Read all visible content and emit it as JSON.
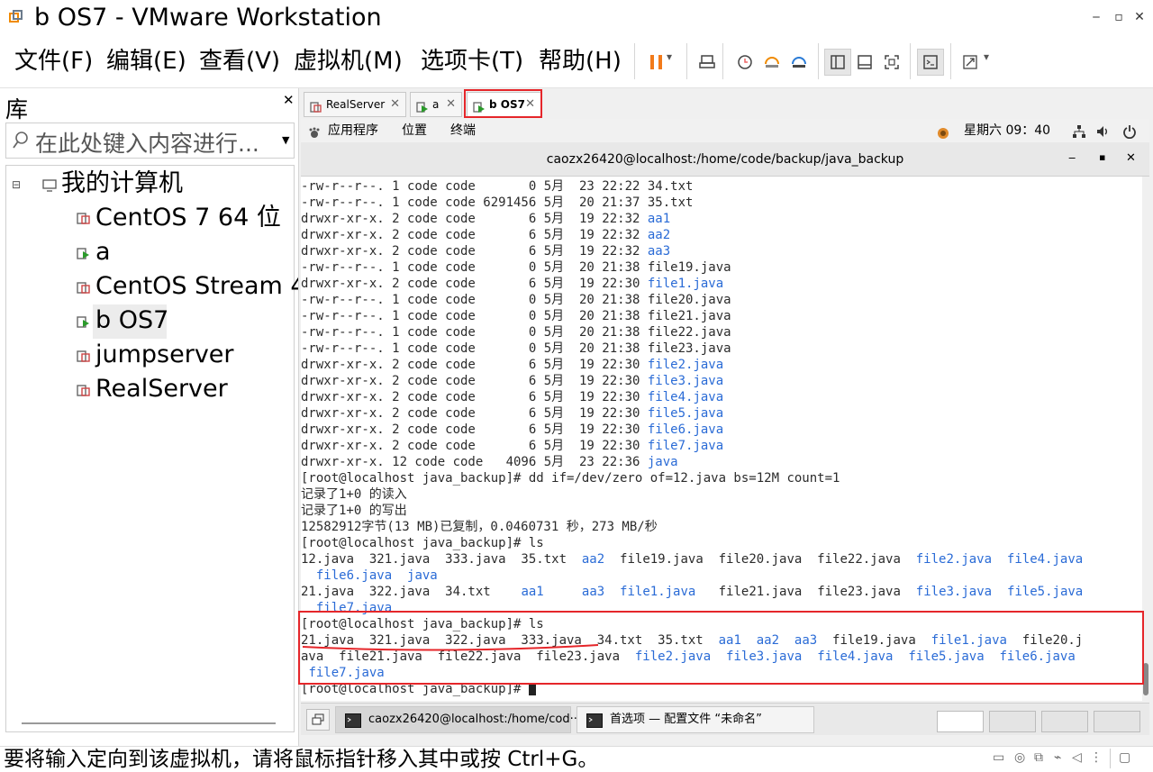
{
  "window": {
    "title": "b OS7 - VMware Workstation",
    "minimize": "‒",
    "restore": "▫",
    "close": "✕"
  },
  "menu": [
    "文件(F)",
    "编辑(E)",
    "查看(V)",
    "虚拟机(M)",
    "选项卡(T)",
    "帮助(H)"
  ],
  "toolbar": {
    "pause_icon": "pause-icon",
    "dropdown": "▾"
  },
  "library": {
    "title": "库",
    "close": "✕",
    "search_placeholder": "在此处键入内容进行...",
    "root": "我的计算机",
    "vms": [
      "CentOS 7 64 位",
      "a",
      "CentOS Stream 4",
      "b OS7",
      "jumpserver",
      "RealServer"
    ],
    "selected": "b OS7"
  },
  "tabs": [
    {
      "label": "RealServer"
    },
    {
      "label": "a"
    },
    {
      "label": "b OS7",
      "active": true
    }
  ],
  "gnome": {
    "apps": "应用程序",
    "places": "位置",
    "terminal": "终端",
    "clock": "星期六 09：40"
  },
  "terminal": {
    "title": "caozx26420@localhost:/home/code/backup/java_backup",
    "lines": [
      [
        {
          "t": "-rw-r--r--. 1 code code       0 5月  23 22:22 34.txt"
        }
      ],
      [
        {
          "t": "-rw-r--r--. 1 code code 6291456 5月  20 21:37 35.txt"
        }
      ],
      [
        {
          "t": "drwxr-xr-x. 2 code code       6 5月  19 22:32 "
        },
        {
          "t": "aa1",
          "c": "blue"
        }
      ],
      [
        {
          "t": "drwxr-xr-x. 2 code code       6 5月  19 22:32 "
        },
        {
          "t": "aa2",
          "c": "blue"
        }
      ],
      [
        {
          "t": "drwxr-xr-x. 2 code code       6 5月  19 22:32 "
        },
        {
          "t": "aa3",
          "c": "blue"
        }
      ],
      [
        {
          "t": "-rw-r--r--. 1 code code       0 5月  20 21:38 file19.java"
        }
      ],
      [
        {
          "t": "drwxr-xr-x. 2 code code       6 5月  19 22:30 "
        },
        {
          "t": "file1.java",
          "c": "blue"
        }
      ],
      [
        {
          "t": "-rw-r--r--. 1 code code       0 5月  20 21:38 file20.java"
        }
      ],
      [
        {
          "t": "-rw-r--r--. 1 code code       0 5月  20 21:38 file21.java"
        }
      ],
      [
        {
          "t": "-rw-r--r--. 1 code code       0 5月  20 21:38 file22.java"
        }
      ],
      [
        {
          "t": "-rw-r--r--. 1 code code       0 5月  20 21:38 file23.java"
        }
      ],
      [
        {
          "t": "drwxr-xr-x. 2 code code       6 5月  19 22:30 "
        },
        {
          "t": "file2.java",
          "c": "blue"
        }
      ],
      [
        {
          "t": "drwxr-xr-x. 2 code code       6 5月  19 22:30 "
        },
        {
          "t": "file3.java",
          "c": "blue"
        }
      ],
      [
        {
          "t": "drwxr-xr-x. 2 code code       6 5月  19 22:30 "
        },
        {
          "t": "file4.java",
          "c": "blue"
        }
      ],
      [
        {
          "t": "drwxr-xr-x. 2 code code       6 5月  19 22:30 "
        },
        {
          "t": "file5.java",
          "c": "blue"
        }
      ],
      [
        {
          "t": "drwxr-xr-x. 2 code code       6 5月  19 22:30 "
        },
        {
          "t": "file6.java",
          "c": "blue"
        }
      ],
      [
        {
          "t": "drwxr-xr-x. 2 code code       6 5月  19 22:30 "
        },
        {
          "t": "file7.java",
          "c": "blue"
        }
      ],
      [
        {
          "t": "drwxr-xr-x. 12 code code   4096 5月  23 22:36 "
        },
        {
          "t": "java",
          "c": "blue"
        }
      ],
      [
        {
          "t": "[root@localhost java_backup]# dd if=/dev/zero of=12.java bs=12M count=1"
        }
      ],
      [
        {
          "t": "记录了1+0 的读入"
        }
      ],
      [
        {
          "t": "记录了1+0 的写出"
        }
      ],
      [
        {
          "t": "12582912字节(13 MB)已复制，0.0460731 秒，273 MB/秒"
        }
      ],
      [
        {
          "t": "[root@localhost java_backup]# ls"
        }
      ],
      [
        {
          "t": "12.java  321.java  333.java  35.txt  "
        },
        {
          "t": "aa2",
          "c": "blue"
        },
        {
          "t": "  file19.java  file20.java  file22.java  "
        },
        {
          "t": "file2.java",
          "c": "blue"
        },
        {
          "t": "  "
        },
        {
          "t": "file4.java",
          "c": "blue"
        }
      ],
      [
        {
          "t": "  "
        },
        {
          "t": "file6.java",
          "c": "blue"
        },
        {
          "t": "  "
        },
        {
          "t": "java",
          "c": "blue"
        }
      ],
      [
        {
          "t": "21.java  322.java  34.txt    "
        },
        {
          "t": "aa1",
          "c": "blue"
        },
        {
          "t": "     "
        },
        {
          "t": "aa3",
          "c": "blue"
        },
        {
          "t": "  "
        },
        {
          "t": "file1.java",
          "c": "blue"
        },
        {
          "t": "   file21.java  file23.java  "
        },
        {
          "t": "file3.java",
          "c": "blue"
        },
        {
          "t": "  "
        },
        {
          "t": "file5.java",
          "c": "blue"
        }
      ],
      [
        {
          "t": "  "
        },
        {
          "t": "file7.java",
          "c": "blue"
        }
      ],
      [
        {
          "t": "[root@localhost java_backup]# ls"
        }
      ],
      [
        {
          "t": "21.java  321.java  322.java  333.java  34.txt  35.txt  "
        },
        {
          "t": "aa1",
          "c": "blue"
        },
        {
          "t": "  "
        },
        {
          "t": "aa2",
          "c": "blue"
        },
        {
          "t": "  "
        },
        {
          "t": "aa3",
          "c": "blue"
        },
        {
          "t": "  file19.java  "
        },
        {
          "t": "file1.java",
          "c": "blue"
        },
        {
          "t": "  file20.j"
        }
      ],
      [
        {
          "t": "ava  file21.java  file22.java  file23.java  "
        },
        {
          "t": "file2.java",
          "c": "blue"
        },
        {
          "t": "  "
        },
        {
          "t": "file3.java",
          "c": "blue"
        },
        {
          "t": "  "
        },
        {
          "t": "file4.java",
          "c": "blue"
        },
        {
          "t": "  "
        },
        {
          "t": "file5.java",
          "c": "blue"
        },
        {
          "t": "  "
        },
        {
          "t": "file6.java",
          "c": "blue"
        }
      ],
      [
        {
          "t": " "
        },
        {
          "t": "file7.java",
          "c": "blue"
        }
      ],
      [
        {
          "t": "[root@localhost java_backup]# "
        }
      ]
    ]
  },
  "taskbar": {
    "item1": "caozx26420@localhost:/home/cod···",
    "item2": "首选项 — 配置文件 “未命名”"
  },
  "status": {
    "message": "要将输入定向到该虚拟机，请将鼠标指针移入其中或按 Ctrl+G。"
  }
}
